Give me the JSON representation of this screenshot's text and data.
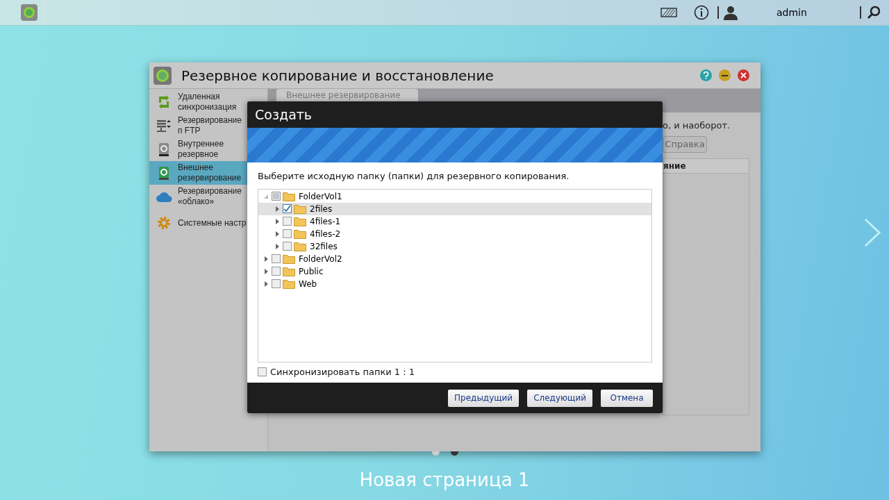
{
  "topbar": {
    "user": "admin"
  },
  "window": {
    "title": "Резервное копирование и восстановление"
  },
  "sidebar": {
    "items": [
      {
        "label": "Удаленная синхронизация",
        "kind": "sync",
        "selected": false
      },
      {
        "label": "Резервирование п FTP",
        "kind": "ftp",
        "selected": false
      },
      {
        "label": "Внутреннее резервное",
        "kind": "disk",
        "selected": false
      },
      {
        "label": "Внешнее резервирование",
        "kind": "external",
        "selected": true
      },
      {
        "label": "Резервирование «облако»",
        "kind": "cloud",
        "selected": false
      },
      {
        "label": "Системные настр",
        "kind": "gear",
        "selected": false
      }
    ]
  },
  "main": {
    "tab": "Внешнее резервирование",
    "description": "о, и наоборот.",
    "help_button": "Справка",
    "column_header": "яние"
  },
  "dialog": {
    "title": "Создать",
    "prompt": "Выберите исходную папку (папки) для резервного копирования.",
    "tree": [
      {
        "label": "FolderVol1",
        "expanded": true,
        "checked": false,
        "partial": true,
        "selected": false,
        "children": [
          {
            "label": "2files",
            "expanded": false,
            "checked": true,
            "partial": false,
            "selected": true
          },
          {
            "label": "4files-1",
            "expanded": false,
            "checked": false,
            "partial": false,
            "selected": false
          },
          {
            "label": "4files-2",
            "expanded": false,
            "checked": false,
            "partial": false,
            "selected": false
          },
          {
            "label": "32files",
            "expanded": false,
            "checked": false,
            "partial": false,
            "selected": false
          }
        ]
      },
      {
        "label": "FolderVol2",
        "expanded": false,
        "checked": false,
        "partial": false,
        "selected": false
      },
      {
        "label": "Public",
        "expanded": false,
        "checked": false,
        "partial": false,
        "selected": false
      },
      {
        "label": "Web",
        "expanded": false,
        "checked": false,
        "partial": false,
        "selected": false
      }
    ],
    "sync_option": {
      "label": "Синхронизировать папки 1 : 1",
      "checked": false
    },
    "buttons": [
      "Предыдущий",
      "Следующий",
      "Отмена"
    ]
  },
  "page_label": "Новая страница 1"
}
